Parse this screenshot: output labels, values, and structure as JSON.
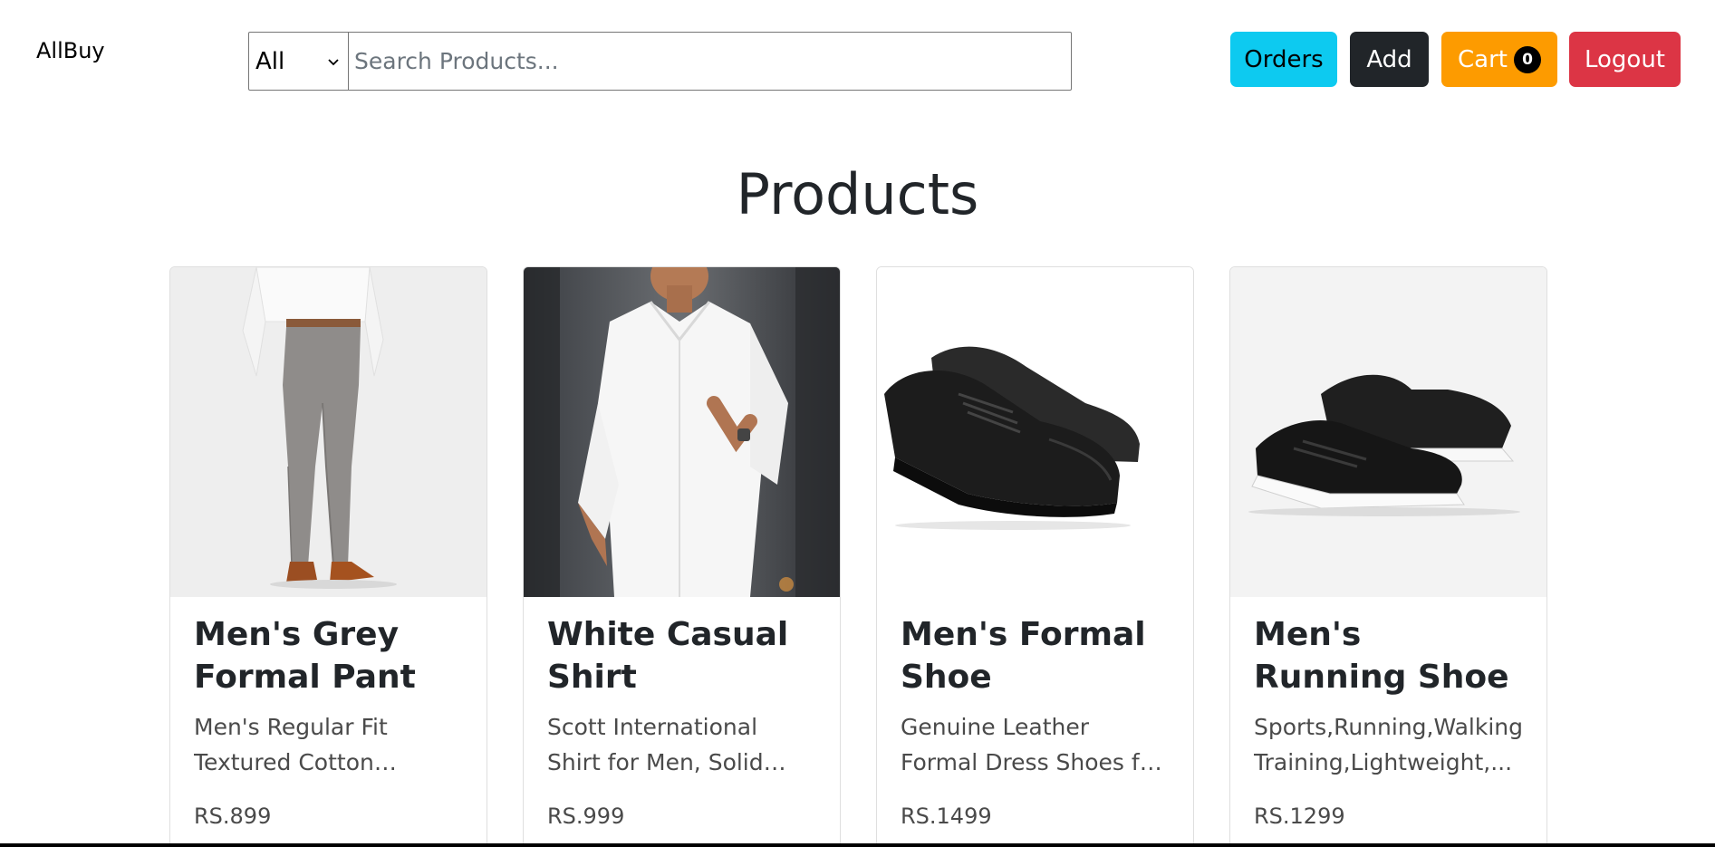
{
  "header": {
    "brand": "AllBuy",
    "category_selected": "All",
    "search_placeholder": "Search Products...",
    "buttons": {
      "orders": "Orders",
      "add": "Add",
      "cart": "Cart",
      "cart_count": "0",
      "logout": "Logout"
    }
  },
  "main": {
    "title": "Products",
    "products": [
      {
        "title": "Men's Grey Formal Pant",
        "description": "Men's Regular Fit Textured Cotton Formal...",
        "price": "RS.899",
        "image_icon": "grey-pant-photo"
      },
      {
        "title": "White Casual Shirt",
        "description": "Scott International Shirt for Men, Solid Full...",
        "price": "RS.999",
        "image_icon": "white-shirt-photo"
      },
      {
        "title": "Men's Formal Shoe",
        "description": "Genuine Leather Formal Dress Shoes for Men |...",
        "price": "RS.1499",
        "image_icon": "formal-shoe-photo"
      },
      {
        "title": "Men's Running Shoe",
        "description": "Sports,Running,Walking, Training,Lightweight,...",
        "price": "RS.1299",
        "image_icon": "running-shoe-photo"
      }
    ]
  },
  "colors": {
    "orders": "#0dcaf0",
    "add": "#212529",
    "cart": "#fd9b00",
    "logout": "#dc3545"
  }
}
